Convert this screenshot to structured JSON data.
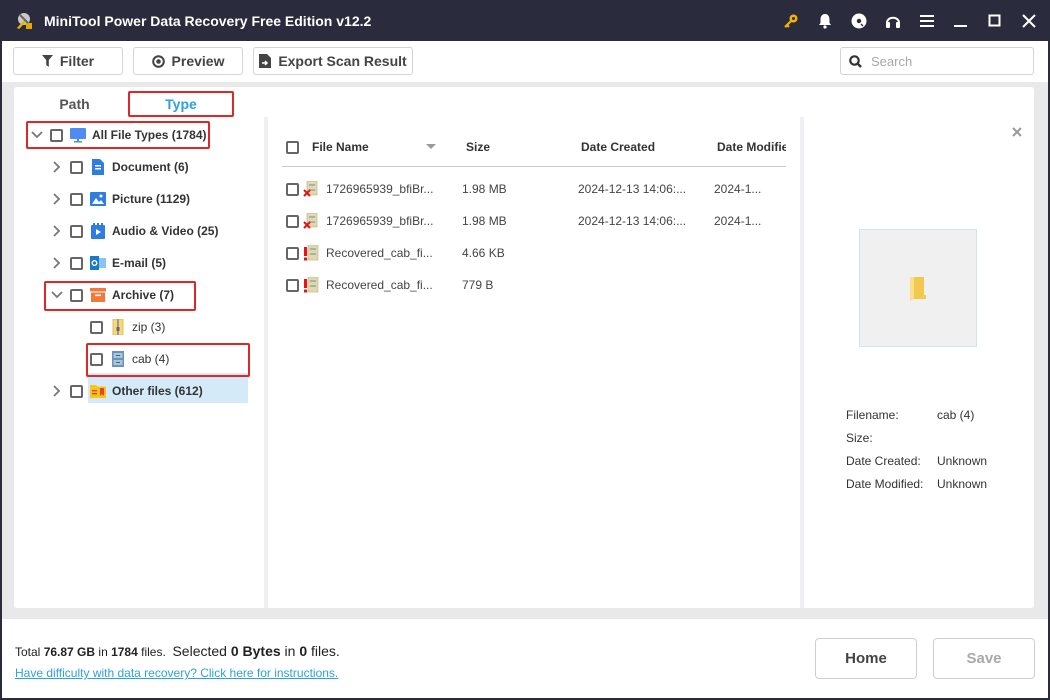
{
  "app": {
    "title": "MiniTool Power Data Recovery Free Edition v12.2",
    "title_icons": [
      "key-icon",
      "bell-icon",
      "disc-icon",
      "headphones-icon",
      "menu-icon",
      "minimize-icon",
      "maximize-icon",
      "close-icon"
    ],
    "key_color": "#f5b400"
  },
  "toolbar": {
    "filter_label": "Filter",
    "preview_label": "Preview",
    "export_label": "Export Scan Result",
    "search_placeholder": "Search",
    "search_value": ""
  },
  "tabs": {
    "path_label": "Path",
    "type_label": "Type",
    "active": "Type",
    "active_color": "#2da0e0"
  },
  "tree": {
    "root": {
      "label": "All File Types (1784)",
      "expanded": true,
      "icon": "monitor-icon"
    },
    "items": [
      {
        "label": "Document (6)",
        "icon": "document-icon",
        "expanded": false
      },
      {
        "label": "Picture (1129)",
        "icon": "picture-icon",
        "expanded": false
      },
      {
        "label": "Audio & Video (25)",
        "icon": "audio-video-icon",
        "expanded": false
      },
      {
        "label": "E-mail (5)",
        "icon": "email-icon",
        "expanded": false
      },
      {
        "label": "Archive (7)",
        "icon": "archive-icon",
        "expanded": true,
        "children": [
          {
            "label": "zip (3)",
            "icon": "zip-icon"
          },
          {
            "label": "cab (4)",
            "icon": "cab-icon",
            "selected": true
          }
        ]
      },
      {
        "label": "Other files (612)",
        "icon": "other-files-icon",
        "expanded": false
      }
    ]
  },
  "table": {
    "columns": [
      "File Name",
      "Size",
      "Date Created",
      "Date Modifie"
    ],
    "rows": [
      {
        "name": "1726965939_bfiBr...",
        "size": "1.98 MB",
        "created": "2024-12-13 14:06:...",
        "modified": "2024-1...",
        "status": "deleted"
      },
      {
        "name": "1726965939_bfiBr...",
        "size": "1.98 MB",
        "created": "2024-12-13 14:06:...",
        "modified": "2024-1...",
        "status": "deleted"
      },
      {
        "name": "Recovered_cab_fi...",
        "size": "4.66 KB",
        "created": "",
        "modified": "",
        "status": "recovered"
      },
      {
        "name": "Recovered_cab_fi...",
        "size": "779 B",
        "created": "",
        "modified": "",
        "status": "recovered"
      }
    ]
  },
  "preview": {
    "filename_label": "Filename:",
    "filename_value": "cab (4)",
    "size_label": "Size:",
    "size_value": "",
    "created_label": "Date Created:",
    "created_value": "Unknown",
    "modified_label": "Date Modified:",
    "modified_value": "Unknown"
  },
  "footer": {
    "total_prefix": "Total ",
    "total_size": "76.87 GB",
    "in1": " in ",
    "total_files": "1784",
    "files1": " files.  ",
    "selected_prefix": "Selected ",
    "selected_size": "0 Bytes",
    "in2": " in ",
    "selected_files": "0",
    "files2": " files.",
    "help_link": "Have difficulty with data recovery? Click here for instructions.",
    "home_label": "Home",
    "save_label": "Save"
  }
}
